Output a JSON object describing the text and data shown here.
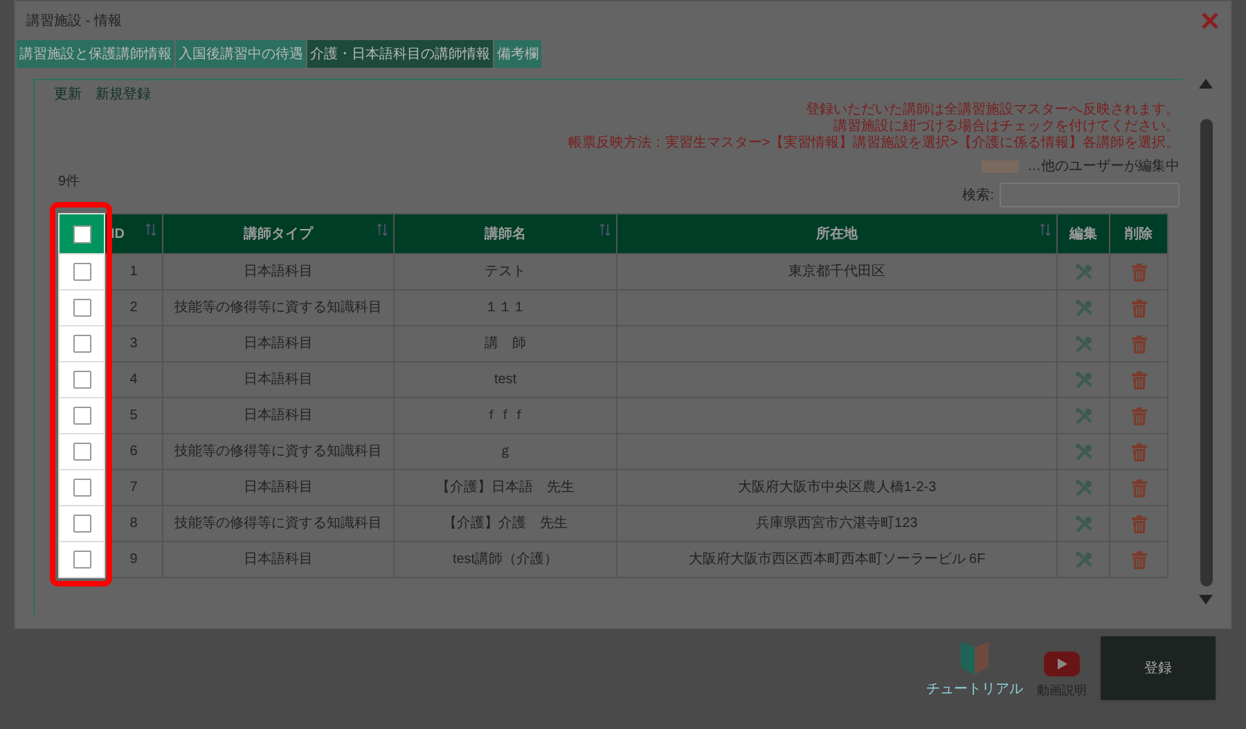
{
  "dialog": {
    "title": "講習施設 - 情報"
  },
  "tabs": [
    {
      "label": "講習施設と保護講師情報",
      "selected": false
    },
    {
      "label": "入国後講習中の待遇",
      "selected": false
    },
    {
      "label": "介護・日本語科目の講師情報",
      "selected": true
    },
    {
      "label": "備考欄",
      "selected": false
    }
  ],
  "toolbar_links": [
    "更新",
    "新規登録"
  ],
  "notices": [
    "登録いただいた講師は全講習施設マスターへ反映されます。",
    "講習施設に紐づける場合はチェックを付けてください。",
    "帳票反映方法：実習生マスター>【実習情報】講習施設を選択>【介護に係る情報】各講師を選択。"
  ],
  "legend": "…他のユーザーが編集中",
  "record_count": "9件",
  "search": {
    "label": "検索:"
  },
  "table": {
    "header_checked": false,
    "columns": [
      {
        "kind": "checkbox"
      },
      {
        "kind": "text",
        "label": "ID",
        "sortable": true
      },
      {
        "kind": "text",
        "label": "講師タイプ",
        "sortable": true
      },
      {
        "kind": "text",
        "label": "講師名",
        "sortable": true
      },
      {
        "kind": "text",
        "label": "所在地",
        "sortable": true
      },
      {
        "kind": "text",
        "label": "編集",
        "sortable": false
      },
      {
        "kind": "text",
        "label": "削除",
        "sortable": false
      }
    ],
    "rows": [
      {
        "checked": false,
        "id": "1",
        "type": "日本語科目",
        "name": "テスト",
        "address": "東京都千代田区"
      },
      {
        "checked": false,
        "id": "2",
        "type": "技能等の修得等に資する知識科目",
        "name": "１１１"
      },
      {
        "checked": false,
        "id": "3",
        "type": "日本語科目",
        "name": "講　師"
      },
      {
        "checked": false,
        "id": "4",
        "type": "日本語科目",
        "name": "test"
      },
      {
        "checked": false,
        "id": "5",
        "type": "日本語科目",
        "name": "ｆｆｆ"
      },
      {
        "checked": false,
        "id": "6",
        "type": "技能等の修得等に資する知識科目",
        "name": "ｇ"
      },
      {
        "checked": false,
        "id": "7",
        "type": "日本語科目",
        "name": "【介護】日本語　先生",
        "address": "大阪府大阪市中央区農人橋1-2-3"
      },
      {
        "checked": false,
        "id": "8",
        "type": "技能等の修得等に資する知識科目",
        "name": "【介護】介護　先生",
        "address": "兵庫県西宮市六湛寺町123"
      },
      {
        "checked": false,
        "id": "9",
        "type": "日本語科目",
        "name": "test講師（介護）",
        "address": "大阪府大阪市西区西本町西本町ソーラービル 6F"
      }
    ]
  },
  "footer": {
    "tutorial": "チュートリアル",
    "video": "動画説明",
    "submit": "登録"
  }
}
